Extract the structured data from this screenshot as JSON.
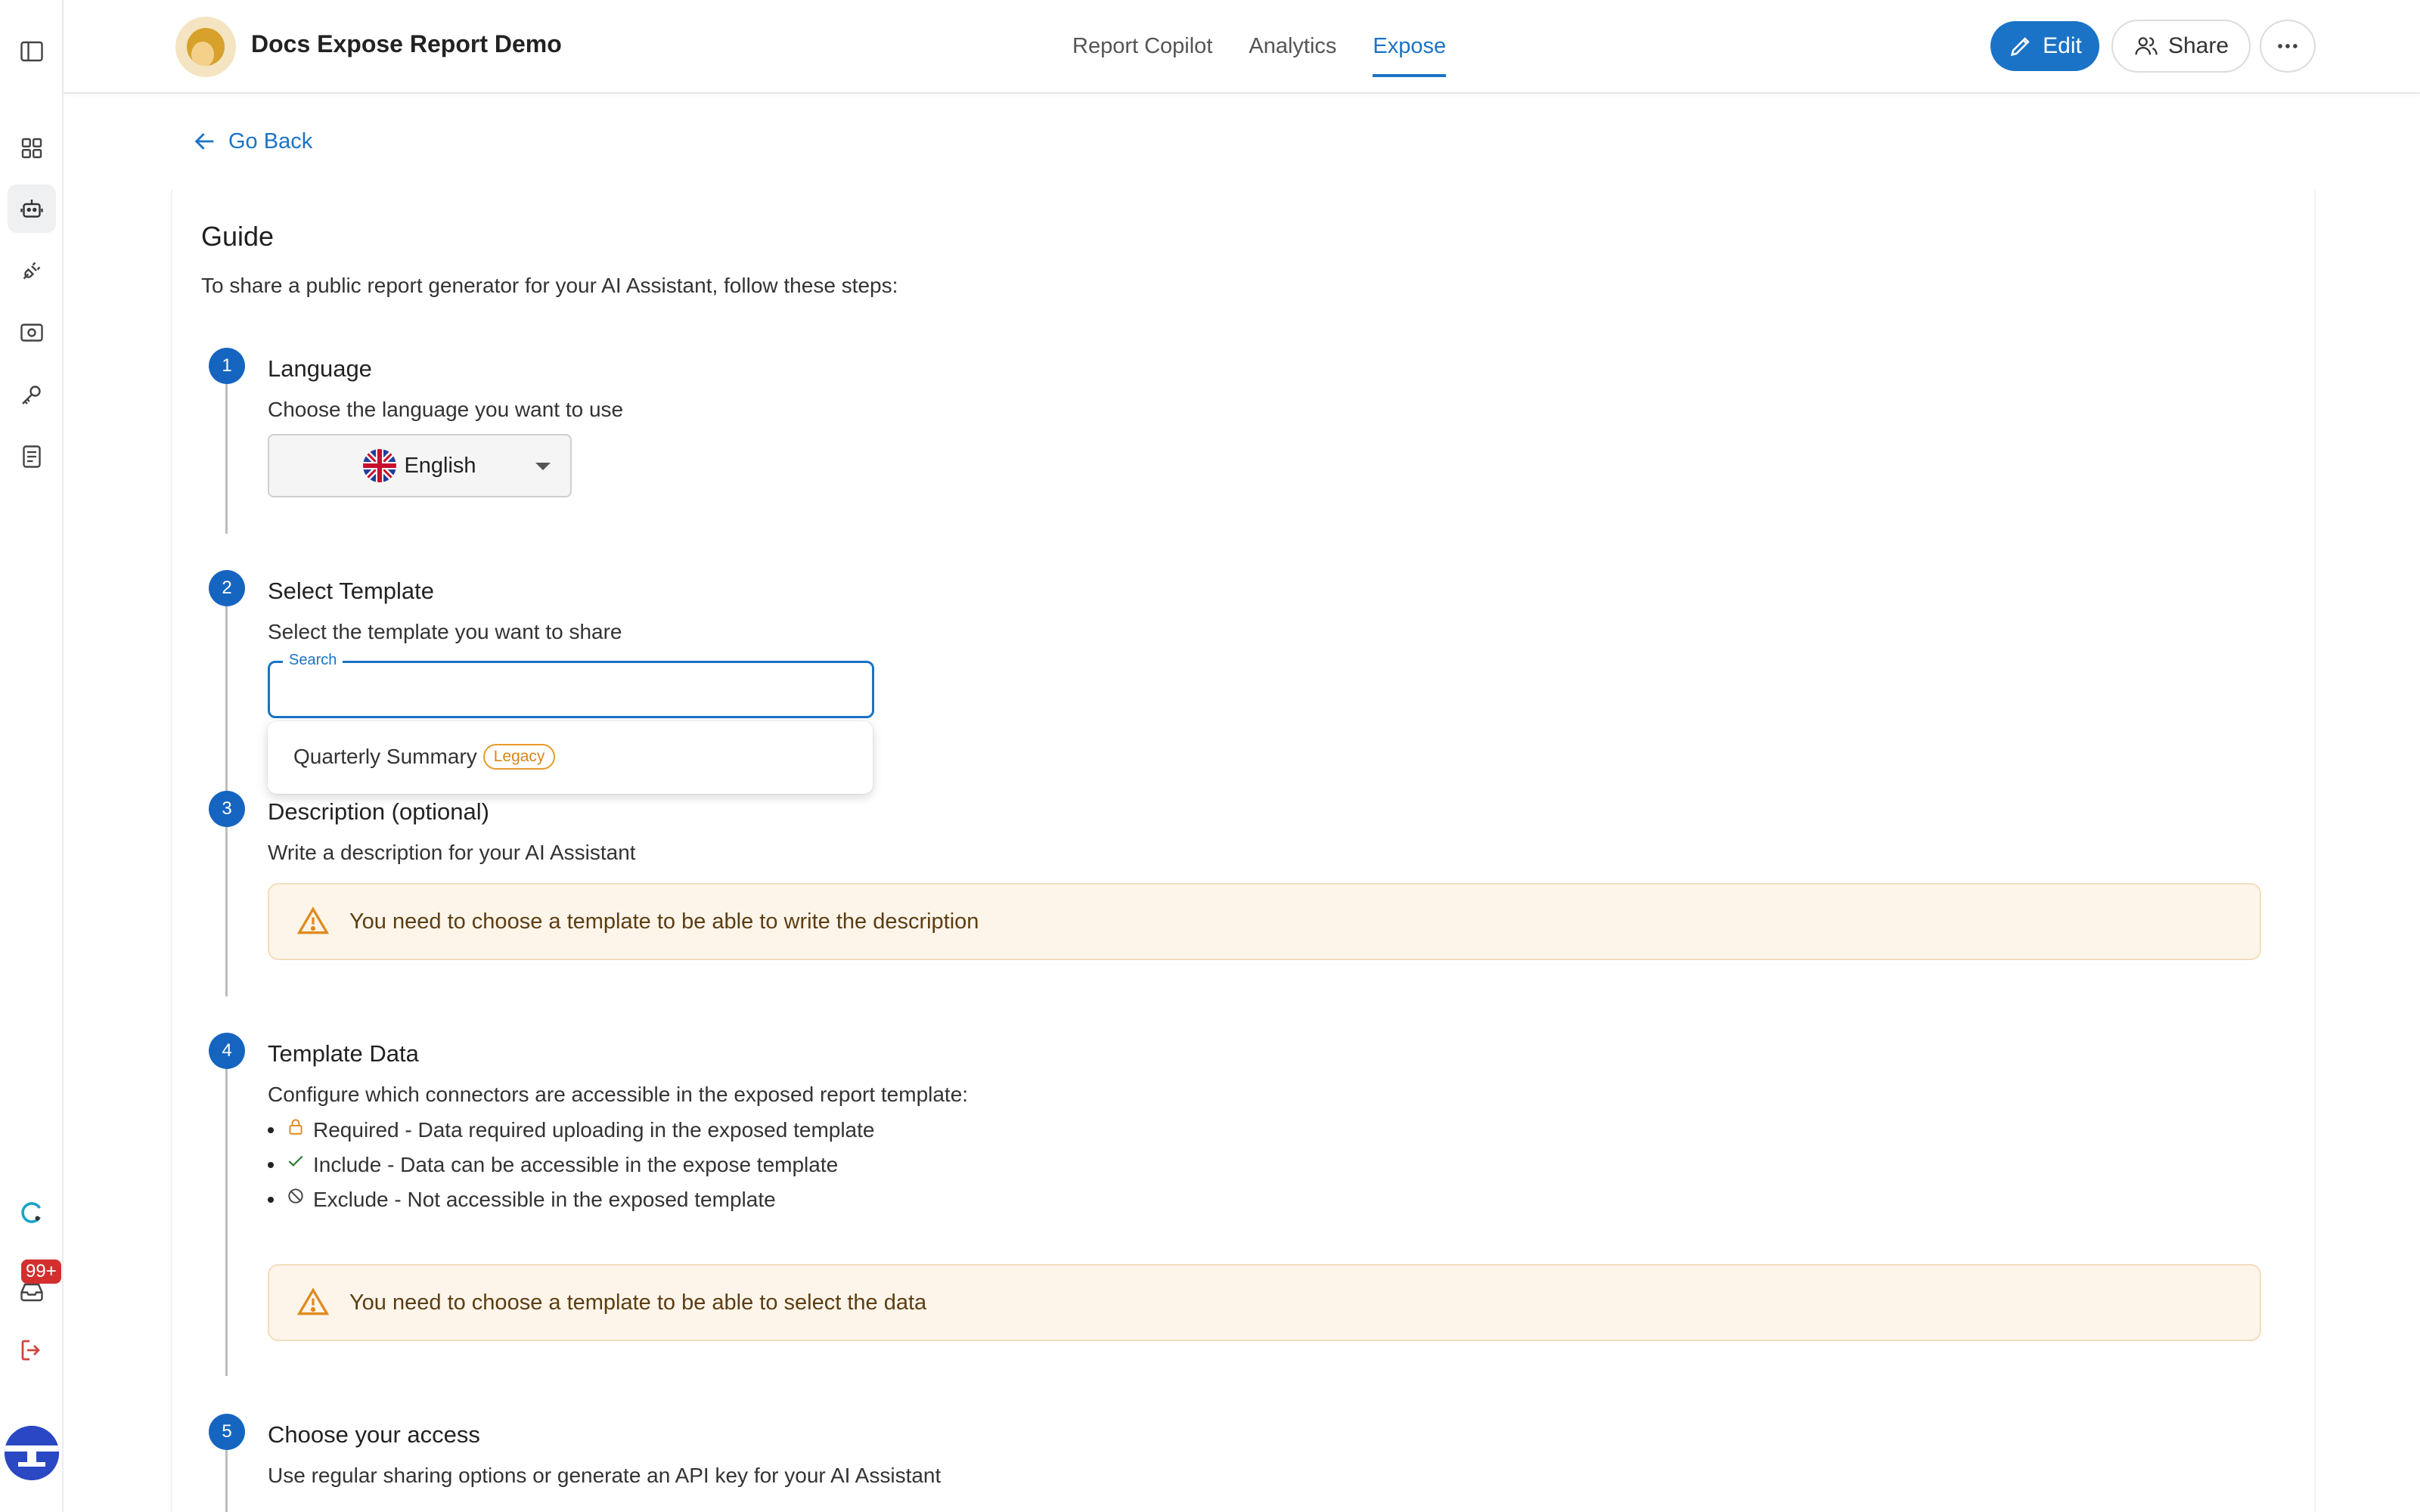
{
  "header": {
    "app_title": "Docs Expose Report Demo",
    "tabs": [
      {
        "label": "Report Copilot",
        "active": false
      },
      {
        "label": "Analytics",
        "active": false
      },
      {
        "label": "Expose",
        "active": true
      }
    ],
    "edit_label": "Edit",
    "share_label": "Share"
  },
  "sidebar": {
    "items": [
      {
        "icon": "sidebar-toggle-icon"
      },
      {
        "icon": "dashboard-grid-icon"
      },
      {
        "icon": "robot-icon",
        "active": true
      },
      {
        "icon": "plug-icon"
      },
      {
        "icon": "settings-panel-icon"
      },
      {
        "icon": "key-icon"
      },
      {
        "icon": "document-icon"
      }
    ],
    "notification_count": "99+"
  },
  "content": {
    "go_back": "Go Back",
    "guide_title": "Guide",
    "guide_subtitle": "To share a public report generator for your AI Assistant, follow these steps:",
    "steps": [
      {
        "number": "1",
        "title": "Language",
        "description": "Choose the language you want to use"
      },
      {
        "number": "2",
        "title": "Select Template",
        "description": "Select the template you want to share"
      },
      {
        "number": "3",
        "title": "Description (optional)",
        "description": "Write a description for your AI Assistant"
      },
      {
        "number": "4",
        "title": "Template Data",
        "description": "Configure which connectors are accessible in the exposed report template:"
      },
      {
        "number": "5",
        "title": "Choose your access",
        "description": "Use regular sharing options or generate an API key for your AI Assistant"
      }
    ],
    "language": {
      "selected": "English"
    },
    "search": {
      "legend": "Search",
      "value": ""
    },
    "template_options": [
      {
        "label": "Quarterly Summary",
        "badge": "Legacy"
      }
    ],
    "description_warning": "You need to choose a template to be able to write the description",
    "data_legend": [
      {
        "icon": "lock-icon",
        "text": "Required - Data required uploading in the exposed template"
      },
      {
        "icon": "check-icon",
        "text": "Include - Data can be accessible in the expose template"
      },
      {
        "icon": "block-icon",
        "text": "Exclude - Not accessible in the exposed template"
      }
    ],
    "data_warning": "You need to choose a template to be able to select the data"
  },
  "colors": {
    "accent": "#1a73c6",
    "step_badge": "#1565c0",
    "warning_bg": "#fdf5ea",
    "warning_border": "#f3ddbd",
    "legacy_badge": "#e89a2c",
    "notification": "#d32f2f"
  }
}
